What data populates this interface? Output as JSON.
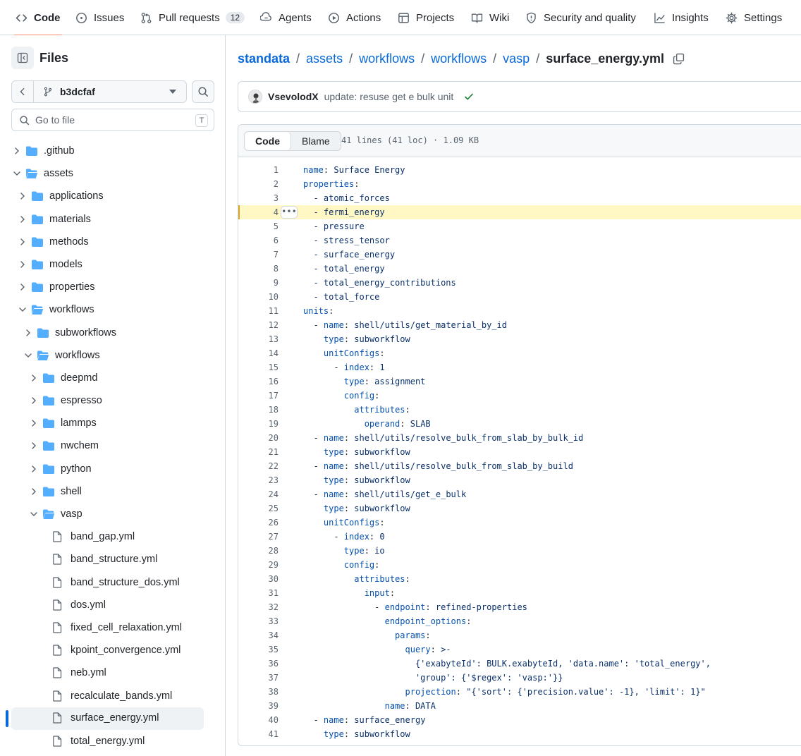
{
  "nav": {
    "tabs": [
      {
        "label": "Code",
        "icon": "code-icon",
        "active": true
      },
      {
        "label": "Issues",
        "icon": "issue-opened-icon"
      },
      {
        "label": "Pull requests",
        "icon": "git-pull-request-icon",
        "count": "12"
      },
      {
        "label": "Agents",
        "icon": "agent-icon"
      },
      {
        "label": "Actions",
        "icon": "play-icon"
      },
      {
        "label": "Projects",
        "icon": "table-icon"
      },
      {
        "label": "Wiki",
        "icon": "book-icon"
      },
      {
        "label": "Security and quality",
        "icon": "shield-icon"
      },
      {
        "label": "Insights",
        "icon": "graph-icon"
      },
      {
        "label": "Settings",
        "icon": "gear-icon"
      }
    ]
  },
  "sidebar": {
    "title": "Files",
    "branch": "b3dcfaf",
    "goto_placeholder": "Go to file",
    "goto_shortcut": "T",
    "tree": [
      {
        "label": ".github",
        "type": "folder",
        "expanded": false
      },
      {
        "label": "assets",
        "type": "folder",
        "expanded": true
      },
      {
        "label": "applications",
        "type": "folder",
        "expanded": false
      },
      {
        "label": "materials",
        "type": "folder",
        "expanded": false
      },
      {
        "label": "methods",
        "type": "folder",
        "expanded": false
      },
      {
        "label": "models",
        "type": "folder",
        "expanded": false
      },
      {
        "label": "properties",
        "type": "folder",
        "expanded": false
      },
      {
        "label": "workflows",
        "type": "folder",
        "expanded": true
      },
      {
        "label": "subworkflows",
        "type": "folder",
        "expanded": false
      },
      {
        "label": "workflows",
        "type": "folder",
        "expanded": true
      },
      {
        "label": "deepmd",
        "type": "folder",
        "expanded": false
      },
      {
        "label": "espresso",
        "type": "folder",
        "expanded": false
      },
      {
        "label": "lammps",
        "type": "folder",
        "expanded": false
      },
      {
        "label": "nwchem",
        "type": "folder",
        "expanded": false
      },
      {
        "label": "python",
        "type": "folder",
        "expanded": false
      },
      {
        "label": "shell",
        "type": "folder",
        "expanded": false
      },
      {
        "label": "vasp",
        "type": "folder",
        "expanded": true
      },
      {
        "label": "band_gap.yml",
        "type": "file"
      },
      {
        "label": "band_structure.yml",
        "type": "file"
      },
      {
        "label": "band_structure_dos.yml",
        "type": "file"
      },
      {
        "label": "dos.yml",
        "type": "file"
      },
      {
        "label": "fixed_cell_relaxation.yml",
        "type": "file"
      },
      {
        "label": "kpoint_convergence.yml",
        "type": "file"
      },
      {
        "label": "neb.yml",
        "type": "file"
      },
      {
        "label": "recalculate_bands.yml",
        "type": "file"
      },
      {
        "label": "surface_energy.yml",
        "type": "file",
        "selected": true
      },
      {
        "label": "total_energy.yml",
        "type": "file"
      }
    ]
  },
  "breadcrumb": {
    "parts": [
      "standata",
      "assets",
      "workflows",
      "workflows",
      "vasp"
    ],
    "current": "surface_energy.yml"
  },
  "commit": {
    "author": "VsevolodX",
    "message": "update: resuse get e bulk unit"
  },
  "file": {
    "view_code": "Code",
    "view_blame": "Blame",
    "info": "41 lines (41 loc) · 1.09 KB",
    "highlighted_line": 4,
    "lines": [
      "name: Surface Energy",
      "properties:",
      "  - atomic_forces",
      "  - fermi_energy",
      "  - pressure",
      "  - stress_tensor",
      "  - surface_energy",
      "  - total_energy",
      "  - total_energy_contributions",
      "  - total_force",
      "units:",
      "  - name: shell/utils/get_material_by_id",
      "    type: subworkflow",
      "    unitConfigs:",
      "      - index: 1",
      "        type: assignment",
      "        config:",
      "          attributes:",
      "            operand: SLAB",
      "  - name: shell/utils/resolve_bulk_from_slab_by_bulk_id",
      "    type: subworkflow",
      "  - name: shell/utils/resolve_bulk_from_slab_by_build",
      "    type: subworkflow",
      "  - name: shell/utils/get_e_bulk",
      "    type: subworkflow",
      "    unitConfigs:",
      "      - index: 0",
      "        type: io",
      "        config:",
      "          attributes:",
      "            input:",
      "              - endpoint: refined-properties",
      "                endpoint_options:",
      "                  params:",
      "                    query: >-",
      "                      {'exabyteId': BULK.exabyteId, 'data.name': 'total_energy',",
      "                      'group': {'$regex': 'vasp:'}}",
      "                    projection: \"{'sort': {'precision.value': -1}, 'limit': 1}\"",
      "                name: DATA",
      "  - name: surface_energy",
      "    type: subworkflow"
    ]
  }
}
